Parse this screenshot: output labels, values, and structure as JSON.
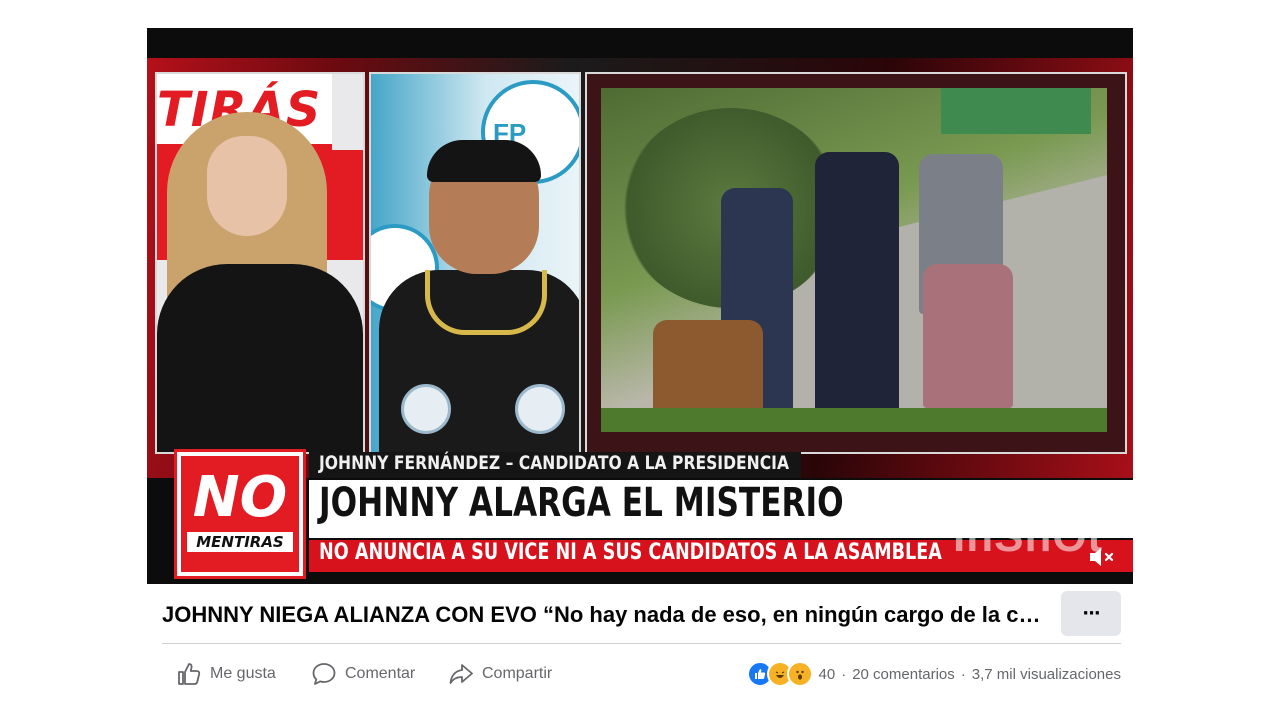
{
  "video": {
    "background_sign": "TIRÁS",
    "poster_text": "FP",
    "logo": {
      "main": "NO",
      "sub": "MENTIRAS"
    },
    "topic_line": "JOHNNY FERNÁNDEZ – CANDIDATO A LA PRESIDENCIA",
    "headline": "JOHNNY ALARGA EL MISTERIO",
    "subheadline": "NO ANUNCIA A SU VICE NI A SUS CANDIDATOS A LA ASAMBLEA",
    "watermark": "InShOt",
    "mute_icon": "speaker-muted-icon"
  },
  "post": {
    "title": "JOHNNY NIEGA ALIANZA CON EVO “No hay nada de eso, en ningún cargo de la candidatura”",
    "more_label": "···"
  },
  "actions": {
    "like_label": "Me gusta",
    "comment_label": "Comentar",
    "share_label": "Compartir"
  },
  "stats": {
    "reaction_count": "40",
    "comments": "20 comentarios",
    "separator": "·",
    "views": "3,7 mil visualizaciones"
  },
  "colors": {
    "brand_red": "#e31b23",
    "fb_gray": "#65676b",
    "like_blue": "#1877f2",
    "haha_yellow": "#f7b125"
  }
}
